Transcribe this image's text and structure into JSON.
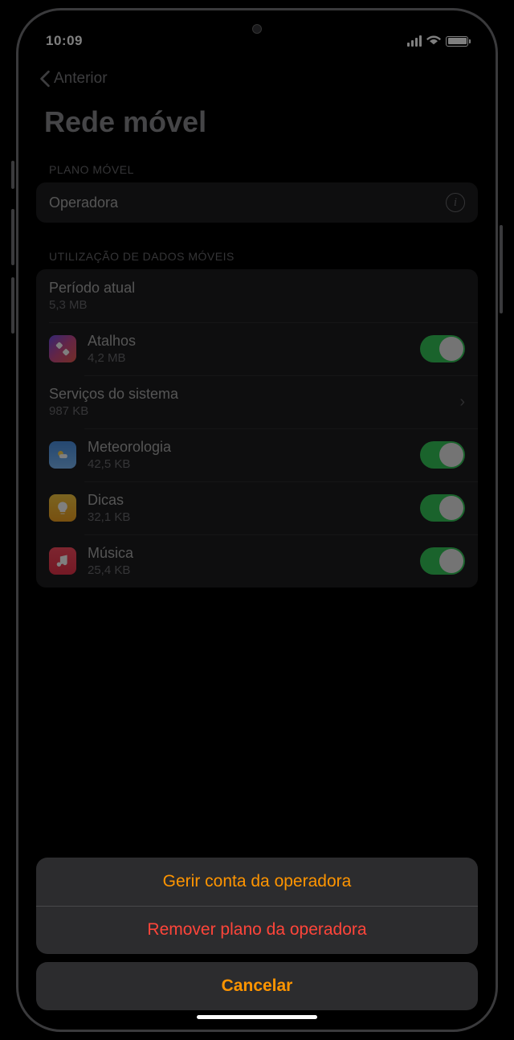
{
  "status": {
    "time": "10:09"
  },
  "nav": {
    "back_label": "Anterior"
  },
  "page": {
    "title": "Rede móvel"
  },
  "sections": {
    "plan_header": "PLANO MÓVEL",
    "carrier_label": "Operadora",
    "usage_header": "UTILIZAÇÃO DE DADOS MÓVEIS",
    "current_period_label": "Período atual",
    "current_period_value": "5,3 MB",
    "system_services_label": "Serviços do sistema",
    "system_services_value": "987 KB"
  },
  "apps": [
    {
      "name": "Atalhos",
      "usage": "4,2 MB"
    },
    {
      "name": "Meteorologia",
      "usage": "42,5 KB"
    },
    {
      "name": "Dicas",
      "usage": "32,1 KB"
    },
    {
      "name": "Música",
      "usage": "25,4 KB"
    }
  ],
  "sheet": {
    "manage": "Gerir conta da operadora",
    "remove": "Remover plano da operadora",
    "cancel": "Cancelar"
  }
}
